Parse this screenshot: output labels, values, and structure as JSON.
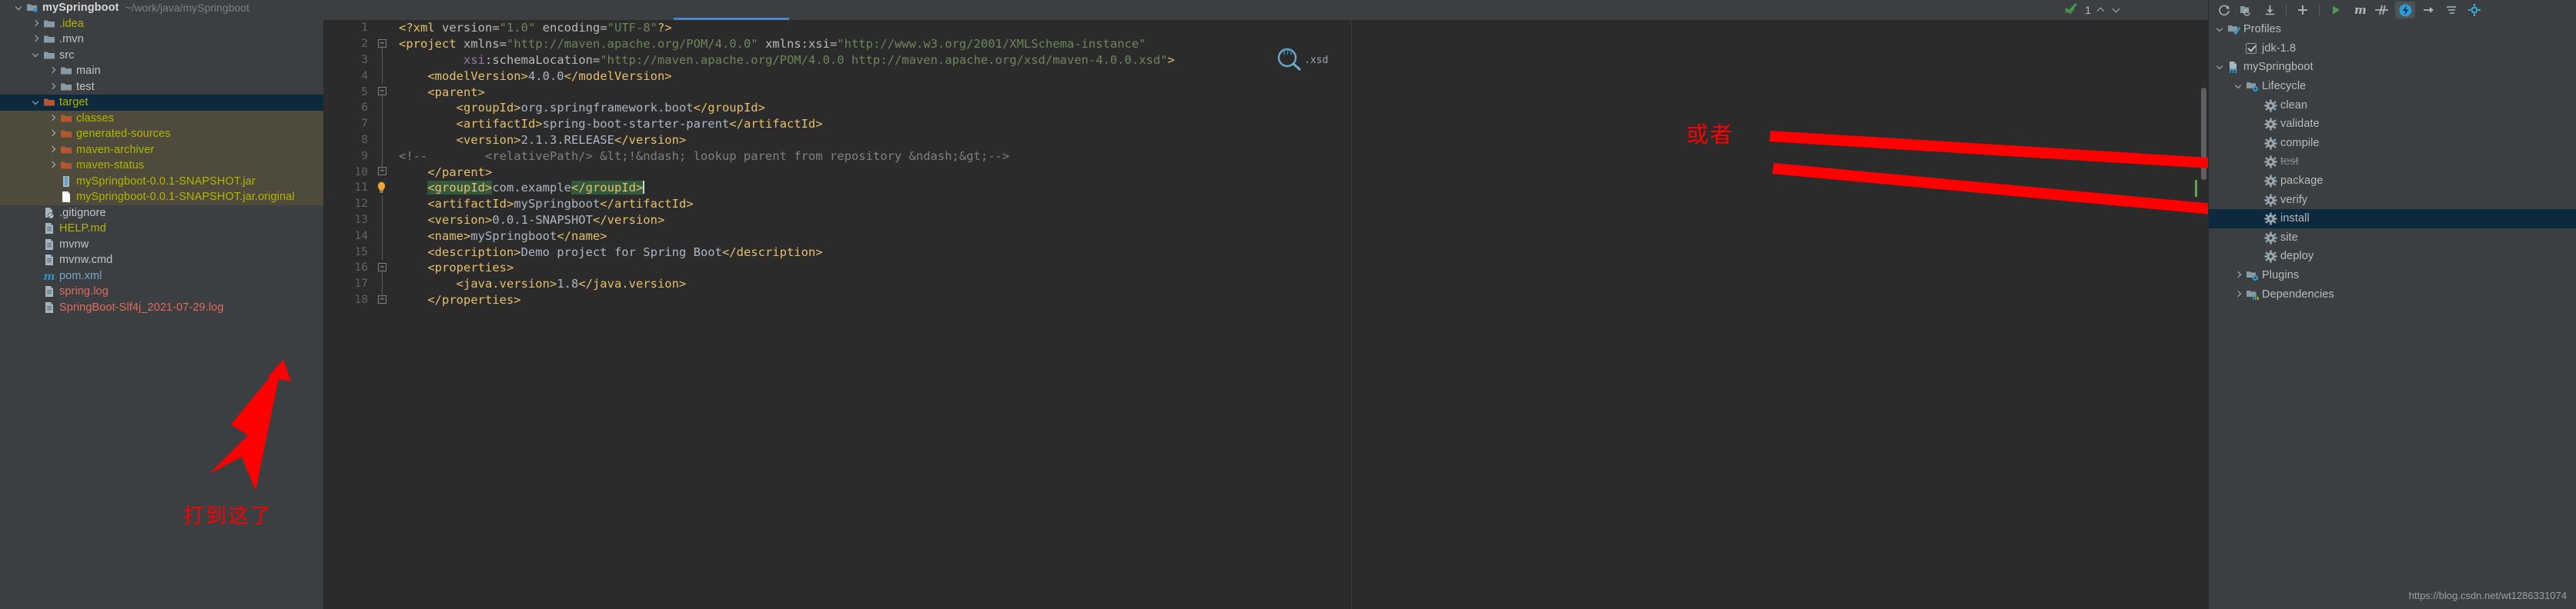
{
  "project": {
    "root": {
      "name": "mySpringboot",
      "path": "~/work/java/mySpringboot"
    },
    "items": [
      {
        "label": ".idea",
        "indent": 1,
        "twisty": "right",
        "icon": "folder-icon",
        "color": "olive",
        "bg": "none"
      },
      {
        "label": ".mvn",
        "indent": 1,
        "twisty": "right",
        "icon": "folder-icon",
        "color": "white",
        "bg": "none"
      },
      {
        "label": "src",
        "indent": 1,
        "twisty": "down",
        "icon": "folder-icon",
        "color": "white",
        "bg": "none"
      },
      {
        "label": "main",
        "indent": 2,
        "twisty": "right",
        "icon": "folder-icon",
        "color": "white",
        "bg": "none"
      },
      {
        "label": "test",
        "indent": 2,
        "twisty": "right",
        "icon": "folder-icon",
        "color": "white",
        "bg": "none"
      },
      {
        "label": "target",
        "indent": 1,
        "twisty": "down",
        "icon": "folder-orange-icon",
        "color": "olive",
        "bg": "sel"
      },
      {
        "label": "classes",
        "indent": 2,
        "twisty": "right",
        "icon": "folder-orange-icon",
        "color": "olive",
        "bg": "tint"
      },
      {
        "label": "generated-sources",
        "indent": 2,
        "twisty": "right",
        "icon": "folder-orange-icon",
        "color": "olive",
        "bg": "tint"
      },
      {
        "label": "maven-archiver",
        "indent": 2,
        "twisty": "right",
        "icon": "folder-orange-icon",
        "color": "olive",
        "bg": "tint"
      },
      {
        "label": "maven-status",
        "indent": 2,
        "twisty": "right",
        "icon": "folder-orange-icon",
        "color": "olive",
        "bg": "tint"
      },
      {
        "label": "mySpringboot-0.0.1-SNAPSHOT.jar",
        "indent": 2,
        "twisty": "none",
        "icon": "jar-icon",
        "color": "olive",
        "bg": "tint"
      },
      {
        "label": "mySpringboot-0.0.1-SNAPSHOT.jar.original",
        "indent": 2,
        "twisty": "none",
        "icon": "file-blank-icon",
        "color": "olive",
        "bg": "tint"
      },
      {
        "label": ".gitignore",
        "indent": 1,
        "twisty": "none",
        "icon": "gitignore-icon",
        "color": "white",
        "bg": "none"
      },
      {
        "label": "HELP.md",
        "indent": 1,
        "twisty": "none",
        "icon": "file-icon",
        "color": "olive",
        "bg": "none"
      },
      {
        "label": "mvnw",
        "indent": 1,
        "twisty": "none",
        "icon": "file-icon",
        "color": "white",
        "bg": "none"
      },
      {
        "label": "mvnw.cmd",
        "indent": 1,
        "twisty": "none",
        "icon": "file-icon",
        "color": "white",
        "bg": "none"
      },
      {
        "label": "pom.xml",
        "indent": 1,
        "twisty": "none",
        "icon": "maven-m-icon",
        "color": "blue",
        "bg": "none"
      },
      {
        "label": "spring.log",
        "indent": 1,
        "twisty": "none",
        "icon": "file-icon",
        "color": "red",
        "bg": "none"
      },
      {
        "label": "SpringBoot-Slf4j_2021-07-29.log",
        "indent": 1,
        "twisty": "none",
        "icon": "file-icon",
        "color": "red",
        "bg": "none"
      }
    ]
  },
  "editor": {
    "inspection_count": "1",
    "lines": [
      {
        "n": "1",
        "fold": "none",
        "html": "<span class='tag'>&lt;?xml </span><span class='attr'>version=</span><span class='str'>\"1.0\"</span><span class='attr'> encoding=</span><span class='str'>\"UTF-8\"</span><span class='tag'>?&gt;</span>"
      },
      {
        "n": "2",
        "fold": "open",
        "html": "<span class='tag'>&lt;project </span><span class='attr'>xmlns=</span><span class='str'>\"http://maven.apache.org/POM/4.0.0\"</span><span class='attr'> xmlns:xsi=</span><span class='str'>\"http://www.w3.org/2001/XMLSchema-instance\"</span>"
      },
      {
        "n": "3",
        "fold": "line",
        "html": "         <span class='ns'>xsi</span><span class='attr'>:schemaLocation=</span><span class='str'>\"http://maven.apache.org/POM/4.0.0 http://maven.apache.org/xsd/maven-4.0.0.xsd\"</span><span class='tag'>&gt;</span>"
      },
      {
        "n": "4",
        "fold": "line",
        "html": "    <span class='tag'>&lt;modelVersion&gt;</span><span class='txtval'>4.0.0</span><span class='tag'>&lt;/modelVersion&gt;</span>"
      },
      {
        "n": "5",
        "fold": "open",
        "html": "    <span class='tag'>&lt;parent&gt;</span>"
      },
      {
        "n": "6",
        "fold": "line",
        "html": "        <span class='tag'>&lt;groupId&gt;</span><span class='txtval'>org.springframework.boot</span><span class='tag'>&lt;/groupId&gt;</span>"
      },
      {
        "n": "7",
        "fold": "line",
        "html": "        <span class='tag'>&lt;artifactId&gt;</span><span class='txtval'>spring-boot-starter-parent</span><span class='tag'>&lt;/artifactId&gt;</span>"
      },
      {
        "n": "8",
        "fold": "line",
        "html": "        <span class='tag'>&lt;version&gt;</span><span class='txtval'>2.1.3.RELEASE</span><span class='tag'>&lt;/version&gt;</span>"
      },
      {
        "n": "9",
        "fold": "line",
        "html": "<span class='cmt'>&lt;!--        &lt;relativePath/&gt; &amp;lt;!&amp;ndash; lookup parent from repository &amp;ndash;&amp;gt;--&gt;</span>"
      },
      {
        "n": "10",
        "fold": "close",
        "html": "    <span class='tag'>&lt;/parent&gt;</span>"
      },
      {
        "n": "11",
        "fold": "bulb",
        "html": "    <span class='tag hl'>&lt;groupId&gt;</span><span class='txtval'>com.example</span><span class='tag hl'>&lt;/groupId&gt;</span><span class='caret'></span>"
      },
      {
        "n": "12",
        "fold": "line",
        "html": "    <span class='tag'>&lt;artifactId&gt;</span><span class='txtval'>mySpringboot</span><span class='tag'>&lt;/artifactId&gt;</span>"
      },
      {
        "n": "13",
        "fold": "line",
        "html": "    <span class='tag'>&lt;version&gt;</span><span class='txtval'>0.0.1-SNAPSHOT</span><span class='tag'>&lt;/version&gt;</span>"
      },
      {
        "n": "14",
        "fold": "line",
        "html": "    <span class='tag'>&lt;name&gt;</span><span class='txtval'>mySpringboot</span><span class='tag'>&lt;/name&gt;</span>"
      },
      {
        "n": "15",
        "fold": "line",
        "html": "    <span class='tag'>&lt;description&gt;</span><span class='txtval'>Demo project for Spring Boot</span><span class='tag'>&lt;/description&gt;</span>"
      },
      {
        "n": "16",
        "fold": "open",
        "html": "    <span class='tag'>&lt;properties&gt;</span>"
      },
      {
        "n": "17",
        "fold": "line",
        "html": "        <span class='tag'>&lt;java.version&gt;</span><span class='txtval'>1.8</span><span class='tag'>&lt;/java.version&gt;</span>"
      },
      {
        "n": "18",
        "fold": "close",
        "html": "    <span class='tag'>&lt;/properties&gt;</span>"
      }
    ]
  },
  "maven": {
    "toolbar": [
      {
        "name": "reload-all-maven-projects-icon"
      },
      {
        "name": "generate-sources-icon"
      },
      {
        "name": "download-sources-icon"
      },
      {
        "name": "separator"
      },
      {
        "name": "add-maven-project-icon"
      },
      {
        "name": "separator"
      },
      {
        "name": "run-maven-build-icon"
      },
      {
        "name": "execute-maven-goal-icon"
      },
      {
        "name": "toggle-skip-tests-icon"
      },
      {
        "name": "show-dependencies-icon"
      },
      {
        "name": "expand-all-icon"
      },
      {
        "name": "collapse-all-icon"
      },
      {
        "name": "settings-icon"
      }
    ],
    "tree": [
      {
        "label": "Profiles",
        "indent": 0,
        "twisty": "down",
        "icon": "profiles-folder-icon",
        "sel": false,
        "strike": false,
        "check": false
      },
      {
        "label": "jdk-1.8",
        "indent": 1,
        "twisty": "none",
        "icon": "checkbox-icon",
        "sel": false,
        "strike": false,
        "check": true
      },
      {
        "label": "mySpringboot",
        "indent": 0,
        "twisty": "down",
        "icon": "maven-project-icon",
        "sel": false,
        "strike": false,
        "check": false
      },
      {
        "label": "Lifecycle",
        "indent": 1,
        "twisty": "down",
        "icon": "lifecycle-folder-icon",
        "sel": false,
        "strike": false,
        "check": false
      },
      {
        "label": "clean",
        "indent": 2,
        "twisty": "none",
        "icon": "goal-gear-icon",
        "sel": false,
        "strike": false,
        "check": false
      },
      {
        "label": "validate",
        "indent": 2,
        "twisty": "none",
        "icon": "goal-gear-icon",
        "sel": false,
        "strike": false,
        "check": false
      },
      {
        "label": "compile",
        "indent": 2,
        "twisty": "none",
        "icon": "goal-gear-icon",
        "sel": false,
        "strike": false,
        "check": false
      },
      {
        "label": "test",
        "indent": 2,
        "twisty": "none",
        "icon": "goal-gear-icon",
        "sel": false,
        "strike": true,
        "check": false
      },
      {
        "label": "package",
        "indent": 2,
        "twisty": "none",
        "icon": "goal-gear-icon",
        "sel": false,
        "strike": false,
        "check": false
      },
      {
        "label": "verify",
        "indent": 2,
        "twisty": "none",
        "icon": "goal-gear-icon",
        "sel": false,
        "strike": false,
        "check": false
      },
      {
        "label": "install",
        "indent": 2,
        "twisty": "none",
        "icon": "goal-gear-icon",
        "sel": true,
        "strike": false,
        "check": false
      },
      {
        "label": "site",
        "indent": 2,
        "twisty": "none",
        "icon": "goal-gear-icon",
        "sel": false,
        "strike": false,
        "check": false
      },
      {
        "label": "deploy",
        "indent": 2,
        "twisty": "none",
        "icon": "goal-gear-icon",
        "sel": false,
        "strike": false,
        "check": false
      },
      {
        "label": "Plugins",
        "indent": 1,
        "twisty": "right",
        "icon": "plugins-folder-icon",
        "sel": false,
        "strike": false,
        "check": false
      },
      {
        "label": "Dependencies",
        "indent": 1,
        "twisty": "right",
        "icon": "dependencies-folder-icon",
        "sel": false,
        "strike": false,
        "check": false
      }
    ]
  },
  "annotations": {
    "sidebar_note": "打到这了",
    "maven_note": "或者"
  },
  "watermark": "https://blog.csdn.net/wt1286331074",
  "colors": {
    "selection_blue": "#0d293e",
    "tint_olive": "#4e4b3c",
    "annotation_red": "#ff0000",
    "tag_orange": "#e8bf6a",
    "string_green": "#6a8759",
    "panel_bg": "#3c3f41",
    "editor_bg": "#2b2b2b"
  }
}
